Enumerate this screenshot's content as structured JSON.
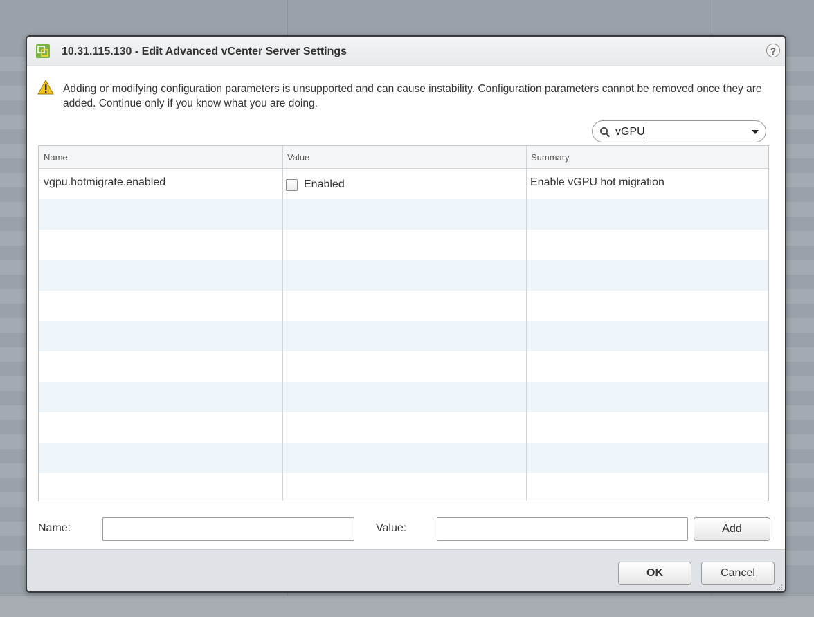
{
  "dialog": {
    "title": "10.31.115.130 - Edit Advanced vCenter Server Settings",
    "help_glyph": "?",
    "warning": "Adding or modifying configuration parameters is unsupported and can cause instability. Configuration parameters cannot be removed once they are added. Continue only if you know what you are doing."
  },
  "search": {
    "value": "vGPU",
    "icon": "search-icon",
    "dropdown_icon": "chevron-down-icon"
  },
  "table": {
    "columns": [
      "Name",
      "Value",
      "Summary"
    ],
    "rows": [
      {
        "name": "vgpu.hotmigrate.enabled",
        "value_checked": false,
        "value_label": "Enabled",
        "summary": "Enable vGPU hot migration"
      }
    ]
  },
  "form": {
    "name_label": "Name:",
    "name_value": "",
    "value_label": "Value:",
    "value_value": "",
    "add_label": "Add"
  },
  "footer": {
    "ok_label": "OK",
    "cancel_label": "Cancel"
  },
  "colors": {
    "row_alt": "#eef5fb",
    "footer_bg": "#dfe3e7",
    "warning_yellow": "#f3c21a"
  }
}
